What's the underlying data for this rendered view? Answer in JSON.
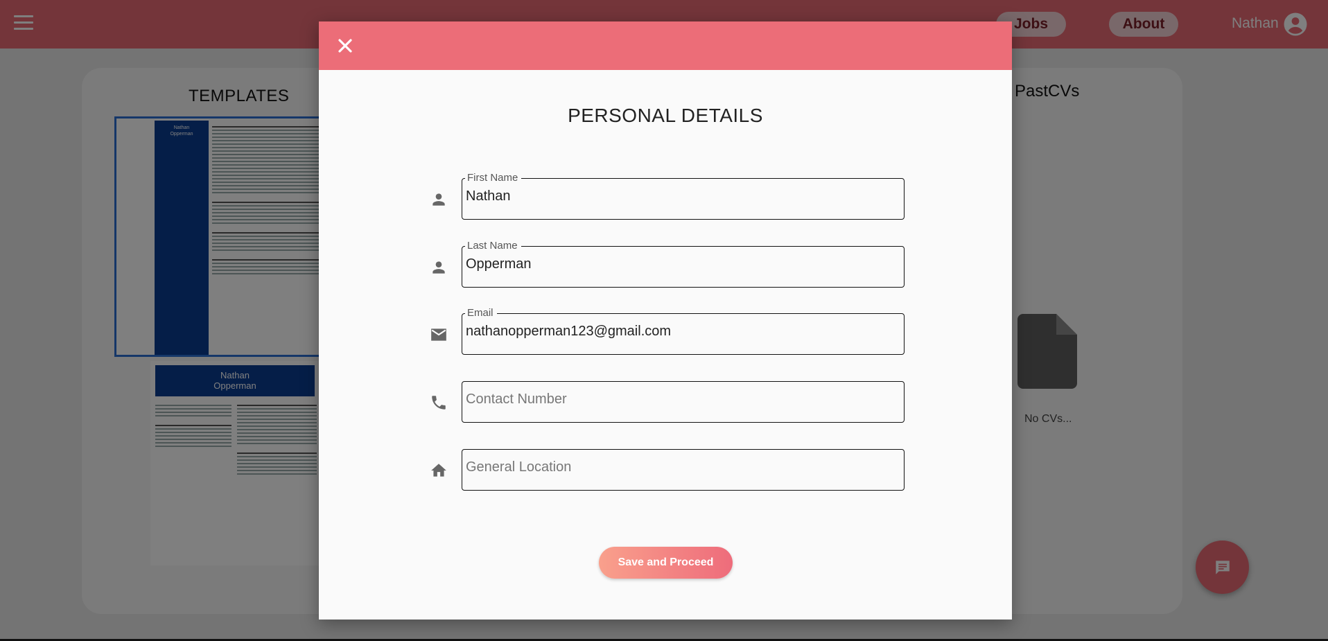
{
  "nav": {
    "jobs_label": "Jobs",
    "about_label": "About",
    "user_name": "Nathan"
  },
  "colors": {
    "brand": "#e96b75",
    "template_accent": "#0b3d91",
    "button_gradient_start": "#f9a08c",
    "button_gradient_end": "#ee6c7b"
  },
  "templates": {
    "title": "TEMPLATES",
    "preview_name_first": "Nathan",
    "preview_name_last": "Opperman"
  },
  "past_cvs": {
    "title": "PastCVs",
    "empty_text": "No CVs..."
  },
  "modal": {
    "title": "PERSONAL DETAILS",
    "fields": [
      {
        "label": "First Name",
        "value": "Nathan",
        "placeholder": "",
        "icon": "person-icon"
      },
      {
        "label": "Last Name",
        "value": "Opperman",
        "placeholder": "",
        "icon": "person-icon"
      },
      {
        "label": "Email",
        "value": "nathanopperman123@gmail.com",
        "placeholder": "",
        "icon": "email-icon"
      },
      {
        "label": "",
        "value": "",
        "placeholder": "Contact Number",
        "icon": "phone-icon"
      },
      {
        "label": "",
        "value": "",
        "placeholder": "General Location",
        "icon": "home-icon"
      }
    ],
    "save_label": "Save and Proceed"
  }
}
